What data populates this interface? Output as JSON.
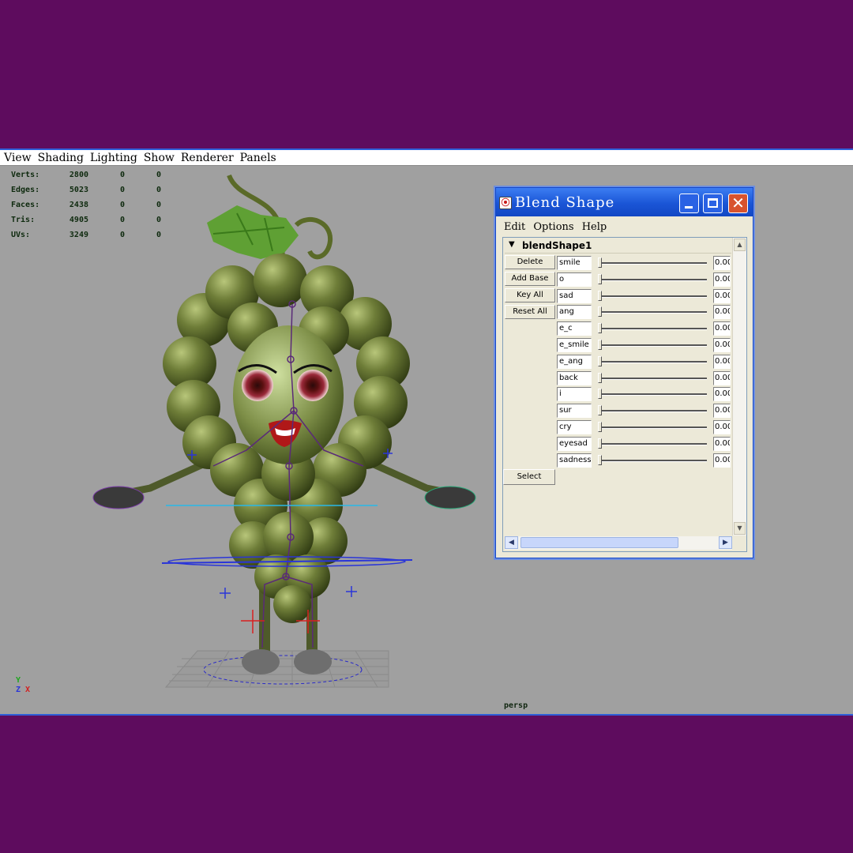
{
  "menubar": {
    "items": [
      "View",
      "Shading",
      "Lighting",
      "Show",
      "Renderer",
      "Panels"
    ]
  },
  "hud": {
    "rows": [
      {
        "label": "Verts:",
        "value": "2800",
        "sel1": "0",
        "sel2": "0"
      },
      {
        "label": "Edges:",
        "value": "5023",
        "sel1": "0",
        "sel2": "0"
      },
      {
        "label": "Faces:",
        "value": "2438",
        "sel1": "0",
        "sel2": "0"
      },
      {
        "label": "Tris:",
        "value": "4905",
        "sel1": "0",
        "sel2": "0"
      },
      {
        "label": "UVs:",
        "value": "3249",
        "sel1": "0",
        "sel2": "0"
      }
    ]
  },
  "axis": {
    "y": "Y",
    "z": "Z",
    "x": "X"
  },
  "camera": "persp",
  "blend_window": {
    "title": "Blend Shape",
    "menu": [
      "Edit",
      "Options",
      "Help"
    ],
    "node_name": "blendShape1",
    "buttons": {
      "delete": "Delete",
      "add_base": "Add Base",
      "key_all": "Key All",
      "reset_all": "Reset All",
      "select": "Select"
    },
    "targets": [
      {
        "name": "smile",
        "value": "0.00",
        "weight": 0
      },
      {
        "name": "o",
        "value": "0.00",
        "weight": 0
      },
      {
        "name": "sad",
        "value": "0.00",
        "weight": 0
      },
      {
        "name": "ang",
        "value": "0.00",
        "weight": 0
      },
      {
        "name": "e_c",
        "value": "0.00",
        "weight": 0
      },
      {
        "name": "e_smile",
        "value": "0.00",
        "weight": 0
      },
      {
        "name": "e_ang",
        "value": "0.00",
        "weight": 0
      },
      {
        "name": "back",
        "value": "0.00",
        "weight": 0
      },
      {
        "name": "i",
        "value": "0.00",
        "weight": 0
      },
      {
        "name": "sur",
        "value": "0.00",
        "weight": 0
      },
      {
        "name": "cry",
        "value": "0.00",
        "weight": 0
      },
      {
        "name": "eyesad",
        "value": "0.00",
        "weight": 0
      },
      {
        "name": "sadness",
        "value": "0.00",
        "weight": 0
      }
    ]
  },
  "colors": {
    "background_band": "#5e0c5e",
    "viewport": "#a0a0a0",
    "titlebar": "#1a55d6",
    "grape": "#6b7a38",
    "joint": "#5a2a78"
  }
}
